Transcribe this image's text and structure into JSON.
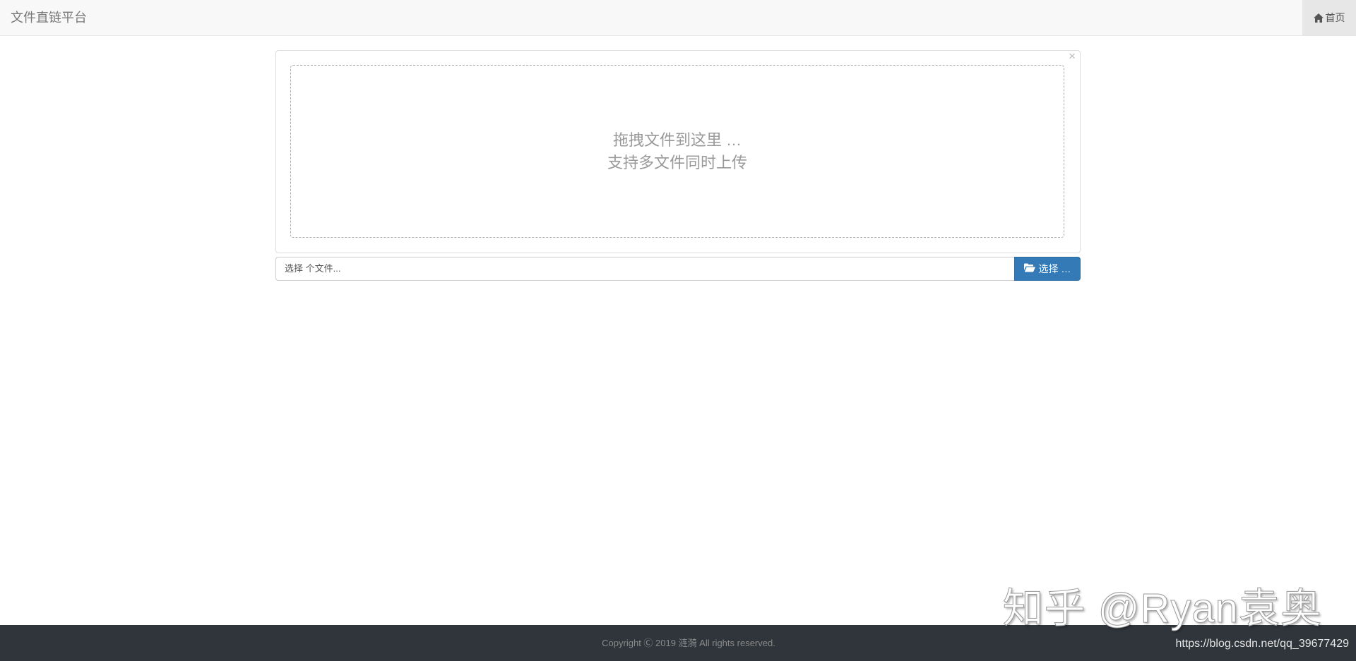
{
  "navbar": {
    "brand": "文件直链平台",
    "home_label": "首页",
    "home_icon": "home-icon"
  },
  "upload": {
    "drop_line1": "拖拽文件到这里 …",
    "drop_line2": "支持多文件同时上传",
    "caption_placeholder": "选择 个文件...",
    "browse_label": "选择 …",
    "browse_icon": "folder-open-icon",
    "close_symbol": "×"
  },
  "footer": {
    "copyright": "Copyright Ⓒ 2019 涟漪 All rights reserved."
  },
  "overlay": {
    "watermark": "知乎 @Ryan袁奥",
    "source_url": "https://blog.csdn.net/qq_39677429"
  },
  "colors": {
    "primary": "#337ab7",
    "navbar_bg": "#f8f8f8",
    "footer_bg": "#2f353b"
  }
}
